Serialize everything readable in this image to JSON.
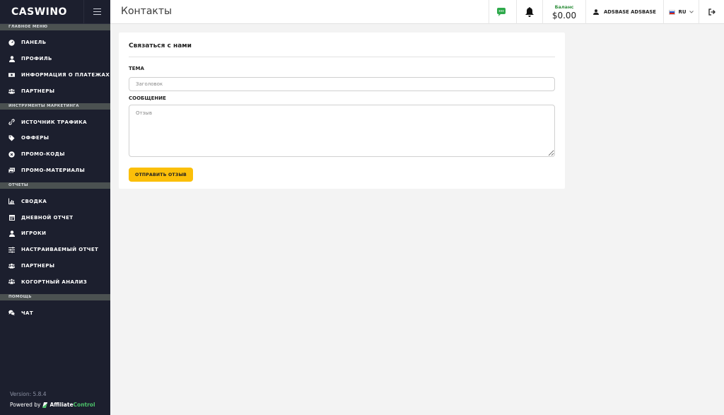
{
  "brand": {
    "name": "CASWINO"
  },
  "sidebar": {
    "sections": [
      {
        "title": "ГЛАВНОЕ МЕНЮ",
        "items": [
          {
            "label": "ПАНЕЛЬ",
            "icon": "dashboard-icon"
          },
          {
            "label": "ПРОФИЛЬ",
            "icon": "user-icon"
          },
          {
            "label": "ИНФОРМАЦИЯ О ПЛАТЕЖАХ",
            "icon": "money-icon"
          },
          {
            "label": "ПАРТНЕРЫ",
            "icon": "users-icon"
          }
        ]
      },
      {
        "title": "ИНСТРУМЕНТЫ МАРКЕТИНГА",
        "items": [
          {
            "label": "ИСТОЧНИК ТРАФИКА",
            "icon": "link-icon"
          },
          {
            "label": "ОФФЕРЫ",
            "icon": "tag-icon"
          },
          {
            "label": "ПРОМО-КОДЫ",
            "icon": "promo-code-icon"
          },
          {
            "label": "ПРОМО-МАТЕРИАЛЫ",
            "icon": "images-icon"
          }
        ]
      },
      {
        "title": "ОТЧЕТЫ",
        "items": [
          {
            "label": "СВОДКА",
            "icon": "chart-icon"
          },
          {
            "label": "ДНЕВНОЙ ОТЧЕТ",
            "icon": "calendar-icon"
          },
          {
            "label": "ИГРОКИ",
            "icon": "user-icon"
          },
          {
            "label": "НАСТРАИВАЕМЫЙ ОТЧЕТ",
            "icon": "sliders-icon"
          },
          {
            "label": "ПАРТНЕРЫ",
            "icon": "users-icon"
          },
          {
            "label": "КОГОРТНЫЙ АНАЛИЗ",
            "icon": "cohort-icon"
          }
        ]
      },
      {
        "title": "ПОМОЩЬ",
        "items": [
          {
            "label": "ЧАТ",
            "icon": "chat-icon"
          }
        ]
      }
    ],
    "footer": {
      "version": "Version: 5.8.4",
      "powered_by": "Powered by",
      "vendor_a": "Affiliate",
      "vendor_b": "Control"
    }
  },
  "topbar": {
    "title": "Контакты",
    "balance_label": "Баланс",
    "balance_value": "$0.00",
    "user_name": "ADSBASE ADSBASE",
    "language": "RU"
  },
  "form": {
    "heading": "Связаться с нами",
    "subject_label": "ТЕМА",
    "subject_placeholder": "Заголовок",
    "message_label": "СООБЩЕНИЕ",
    "message_placeholder": "Отзыв",
    "submit_label": "ОТПРАВИТЬ ОТЗЫВ"
  },
  "colors": {
    "sidebar_bg": "#1c1f2e",
    "section_bg": "#4b5151",
    "accent_button": "#fbbf09",
    "balance_label": "#2f8f3c",
    "chat_icon": "#2faa4c"
  }
}
